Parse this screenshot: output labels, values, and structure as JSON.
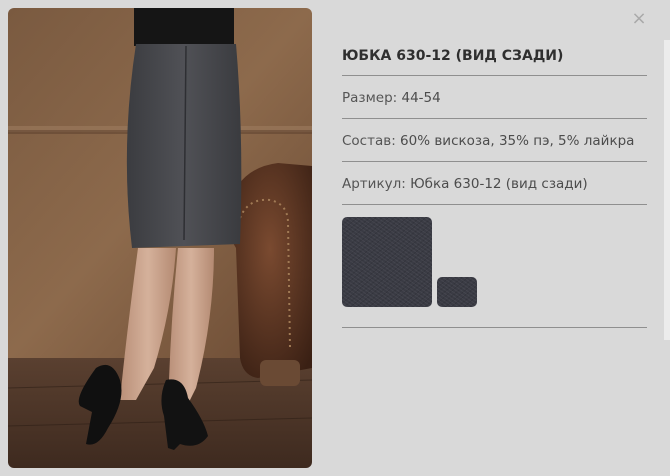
{
  "product": {
    "title": "ЮБКА 630-12 (ВИД СЗАДИ)",
    "size_label": "Размер:",
    "size_value": "44-54",
    "composition_label": "Состав:",
    "composition_value": "60% вискоза, 35% пэ, 5% лайкра",
    "article_label": "Артикул:",
    "article_value": "Юбка 630-12 (вид сзади)"
  },
  "close_label": "×",
  "swatches": [
    {
      "name": "dark-grey",
      "color": "#3a3b44"
    },
    {
      "name": "dark-grey-small",
      "color": "#3a3b44"
    }
  ],
  "colors": {
    "background": "#d9d9d9",
    "divider": "#8f8f8f",
    "title": "#2f2f2f"
  }
}
